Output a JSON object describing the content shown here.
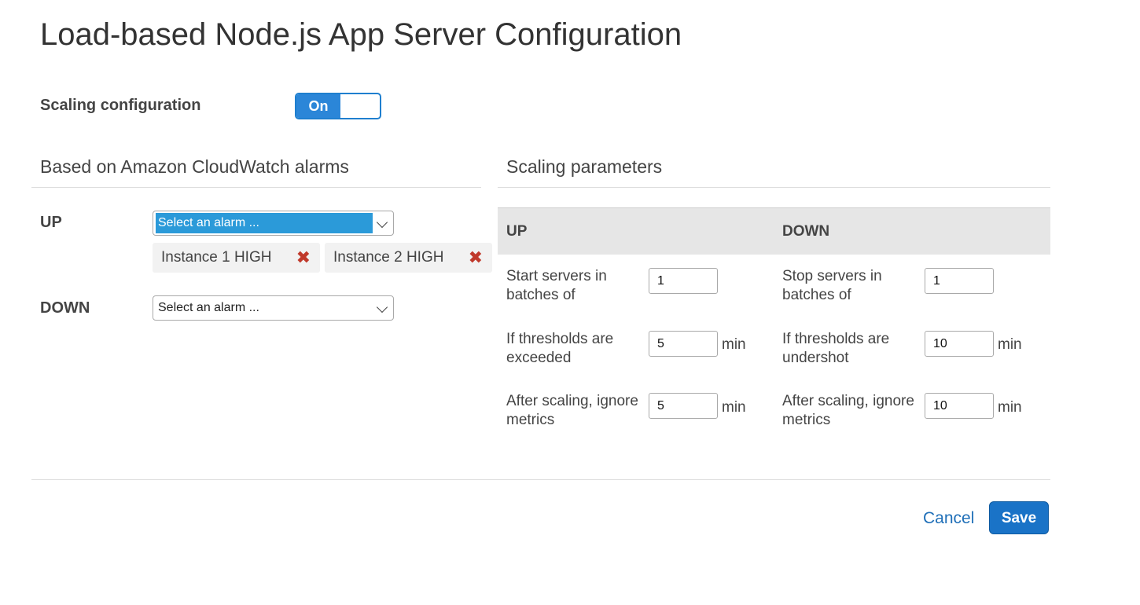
{
  "page": {
    "title": "Load-based Node.js App Server Configuration"
  },
  "scaling": {
    "label": "Scaling configuration",
    "toggle_label": "On",
    "enabled": true
  },
  "alarms": {
    "title": "Based on Amazon CloudWatch alarms",
    "up": {
      "label": "UP",
      "select_value": "Select an alarm ...",
      "chips": [
        "Instance 1 HIGH",
        "Instance 2 HIGH"
      ]
    },
    "down": {
      "label": "DOWN",
      "select_value": "Select an alarm ..."
    }
  },
  "params": {
    "title": "Scaling parameters",
    "up_header": "UP",
    "down_header": "DOWN",
    "up": [
      {
        "label": "Start servers in batches of",
        "value": "1",
        "unit": ""
      },
      {
        "label": "If thresholds are exceeded",
        "value": "5",
        "unit": "min"
      },
      {
        "label": "After scaling, ignore metrics",
        "value": "5",
        "unit": "min"
      }
    ],
    "down": [
      {
        "label": "Stop servers in batches of",
        "value": "1",
        "unit": ""
      },
      {
        "label": "If thresholds are undershot",
        "value": "10",
        "unit": "min"
      },
      {
        "label": "After scaling, ignore metrics",
        "value": "10",
        "unit": "min"
      }
    ]
  },
  "actions": {
    "cancel_label": "Cancel",
    "save_label": "Save"
  },
  "colors": {
    "accent": "#1a73c7",
    "select_highlight": "#2b9ad9",
    "remove": "#c0392b"
  }
}
